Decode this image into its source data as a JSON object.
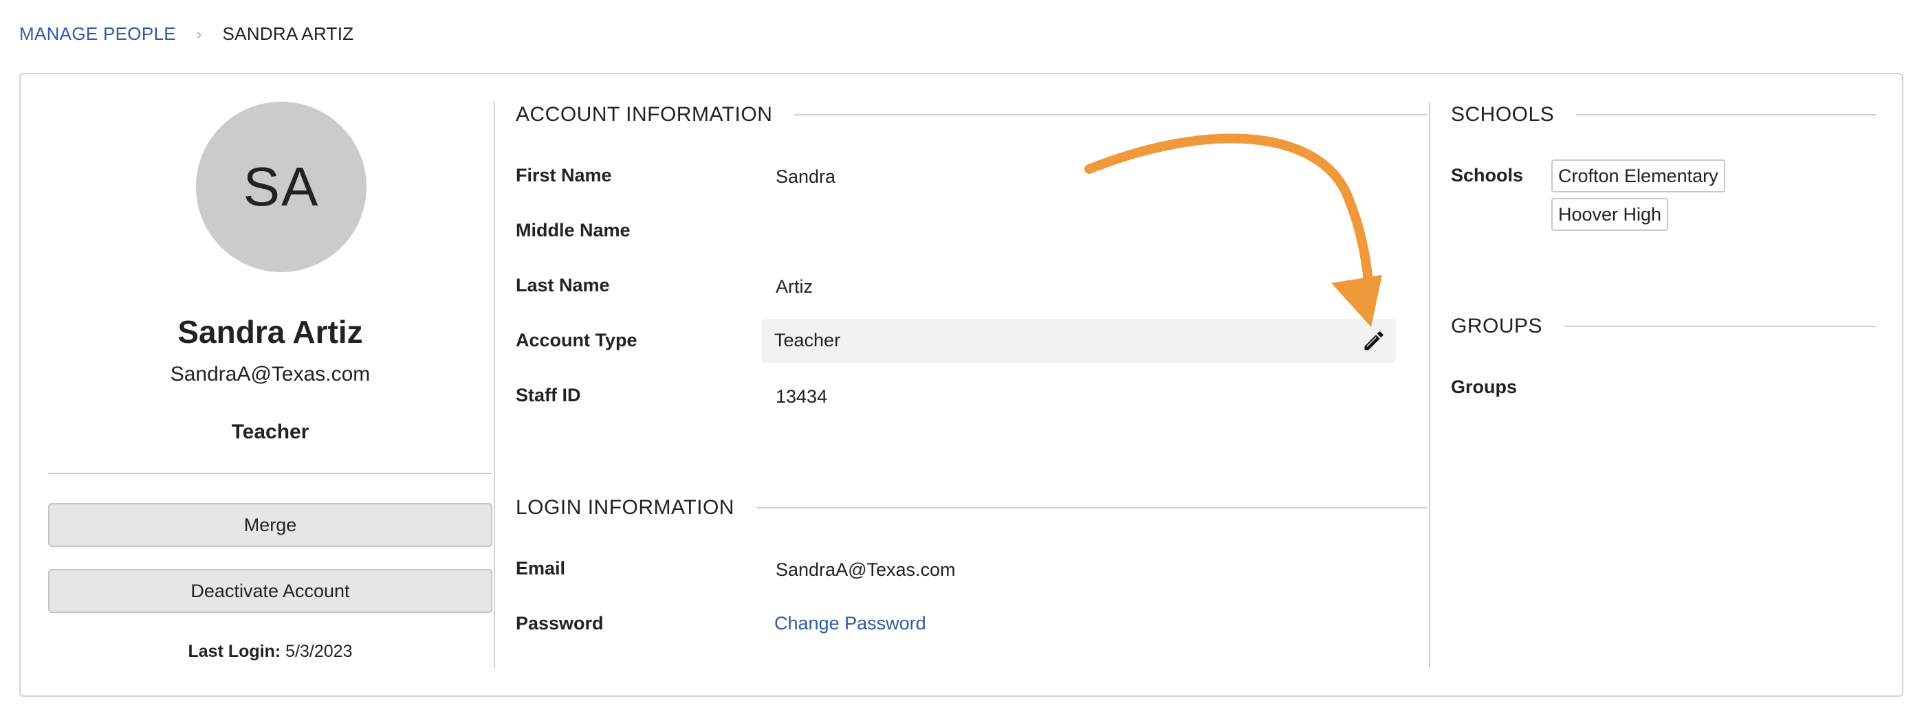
{
  "breadcrumb": {
    "parent": "MANAGE PEOPLE",
    "separator": "›",
    "current": "SANDRA ARTIZ"
  },
  "profile": {
    "initials": "SA",
    "name": "Sandra Artiz",
    "email": "SandraA@Texas.com",
    "role": "Teacher",
    "merge_label": "Merge",
    "deactivate_label": "Deactivate Account",
    "last_login_label": "Last Login:",
    "last_login_value": "5/3/2023"
  },
  "account_info": {
    "title": "ACCOUNT INFORMATION",
    "first_name_label": "First Name",
    "first_name": "Sandra",
    "middle_name_label": "Middle Name",
    "middle_name": "",
    "last_name_label": "Last Name",
    "last_name": "Artiz",
    "account_type_label": "Account Type",
    "account_type": "Teacher",
    "staff_id_label": "Staff ID",
    "staff_id": "13434"
  },
  "login_info": {
    "title": "LOGIN INFORMATION",
    "email_label": "Email",
    "email": "SandraA@Texas.com",
    "password_label": "Password",
    "change_password": "Change Password"
  },
  "schools": {
    "title": "SCHOOLS",
    "label": "Schools",
    "items": [
      "Crofton Elementary",
      "Hoover High"
    ]
  },
  "groups": {
    "title": "GROUPS",
    "label": "Groups"
  },
  "icons": {
    "edit": "pencil-icon",
    "annotation": "arrow-annotation"
  },
  "colors": {
    "link": "#2f5aa5",
    "annotation": "#f0993a",
    "avatar_bg": "#cbcbcb"
  }
}
